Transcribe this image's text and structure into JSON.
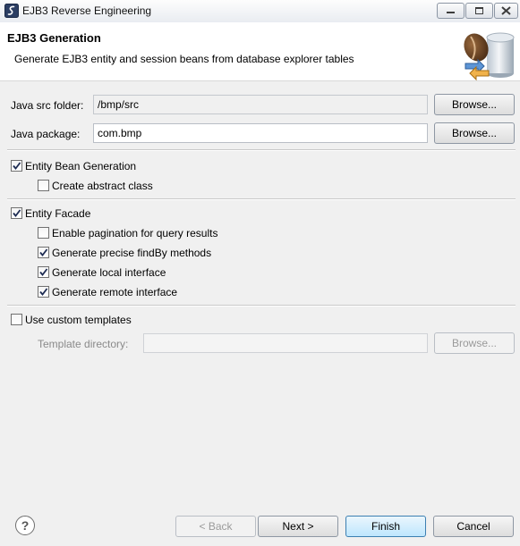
{
  "window": {
    "title": "EJB3 Reverse Engineering"
  },
  "header": {
    "title": "EJB3 Generation",
    "description": "Generate EJB3 entity and session beans from database explorer tables"
  },
  "form": {
    "java_src_folder": {
      "label": "Java src folder:",
      "value": "/bmp/src",
      "browse_label": "Browse..."
    },
    "java_package": {
      "label": "Java package:",
      "value": "com.bmp",
      "browse_label": "Browse..."
    },
    "entity_bean_generation": {
      "label": "Entity Bean Generation",
      "checked": true
    },
    "create_abstract_class": {
      "label": "Create abstract class",
      "checked": false
    },
    "entity_facade": {
      "label": "Entity Facade",
      "checked": true
    },
    "enable_pagination": {
      "label": "Enable pagination for query results",
      "checked": false
    },
    "generate_precise_findby": {
      "label": "Generate precise findBy methods",
      "checked": true
    },
    "generate_local_interface": {
      "label": "Generate local interface",
      "checked": true
    },
    "generate_remote_interface": {
      "label": "Generate remote interface",
      "checked": true
    },
    "use_custom_templates": {
      "label": "Use custom templates",
      "checked": false
    },
    "template_directory": {
      "label": "Template directory:",
      "value": "",
      "browse_label": "Browse..."
    }
  },
  "footer": {
    "help_symbol": "?",
    "back_label": "< Back",
    "next_label": "Next >",
    "finish_label": "Finish",
    "cancel_label": "Cancel"
  }
}
